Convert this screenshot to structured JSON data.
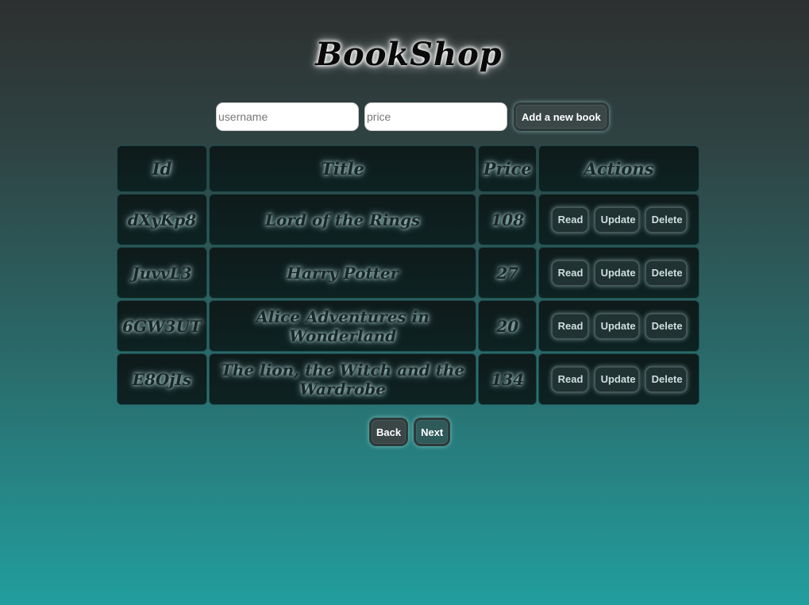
{
  "app": {
    "title": "BookShop"
  },
  "form": {
    "username_placeholder": "username",
    "price_placeholder": "price",
    "add_label": "Add a new book"
  },
  "table": {
    "headers": [
      "Id",
      "Title",
      "Price",
      "Actions"
    ],
    "rows": [
      {
        "id": "dXyKp8",
        "title": "Lord of the Rings",
        "price": "108"
      },
      {
        "id": "JuvvL3",
        "title": "Harry Potter",
        "price": "27"
      },
      {
        "id": "6GW3UT",
        "title": "Alice Adventures in Wonderland",
        "price": "20"
      },
      {
        "id": "E8OjIs",
        "title": "The lion, the Witch and the Wardrobe",
        "price": "134"
      }
    ],
    "action_labels": {
      "read": "Read",
      "update": "Update",
      "delete": "Delete"
    }
  },
  "pager": {
    "back_label": "Back",
    "next_label": "Next"
  },
  "colors": {
    "accent": "#229e9e",
    "cell_bg": "#0f1a1a",
    "button_bg": "#3b4747"
  }
}
